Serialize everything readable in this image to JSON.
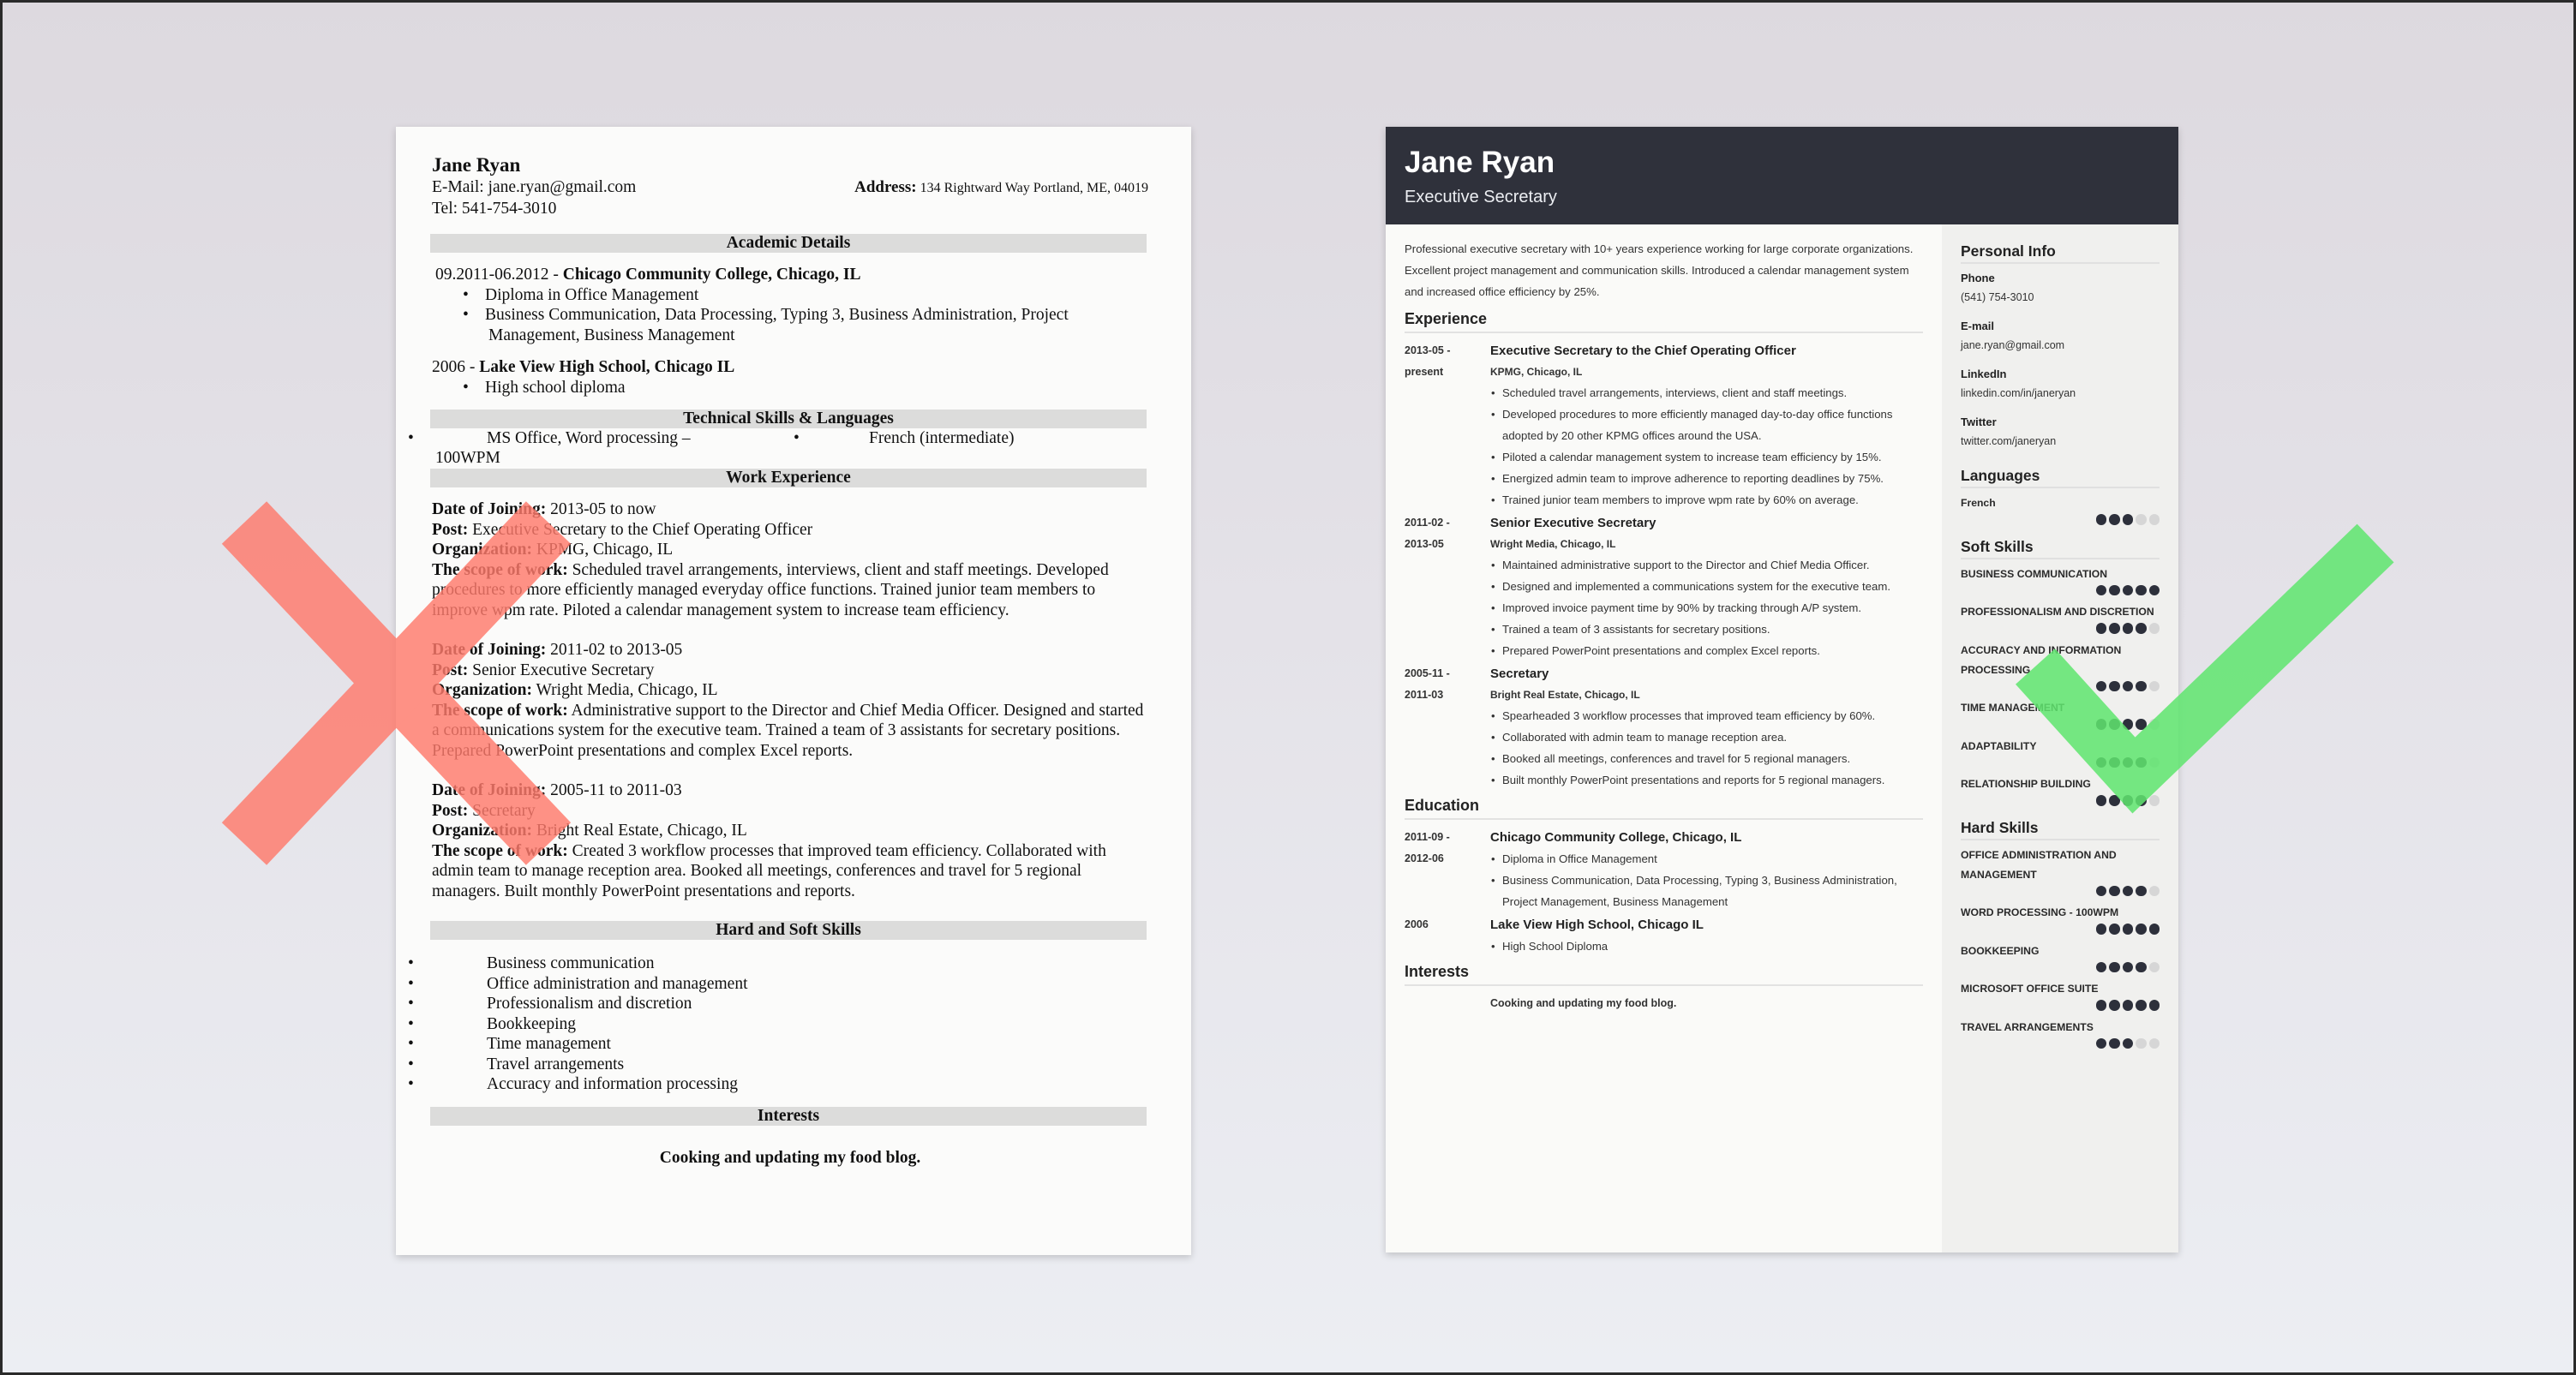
{
  "bad_resume": {
    "name": "Jane Ryan",
    "email_label": "E-Mail:",
    "email": "jane.ryan@gmail.com",
    "address_label": "Address:",
    "address": "134 Rightward Way Portland, ME, 04019",
    "tel_label": "Tel:",
    "tel": "541-754-3010",
    "sections": {
      "academic": "Academic Details",
      "technical": "Technical Skills & Languages",
      "work": "Work Experience",
      "skills": "Hard and Soft Skills",
      "interests": "Interests"
    },
    "education": [
      {
        "dates": "09.2011-06.2012 - ",
        "school": "Chicago Community College, Chicago, IL",
        "items": [
          "Diploma in Office Management",
          "Business Communication, Data Processing, Typing 3, Business Administration, Project",
          "Management, Business Management"
        ]
      },
      {
        "dates": "2006 - ",
        "school": "Lake View High School, Chicago IL",
        "items": [
          "High school diploma"
        ]
      }
    ],
    "technical": {
      "item1_line1": "MS Office, Word processing –",
      "item1_line2": "100WPM",
      "item2": "French (intermediate)"
    },
    "labels": {
      "date": "Date of Joining:",
      "post": "Post:",
      "org": "Organization:",
      "scope": "The scope of work:"
    },
    "jobs": [
      {
        "date": "2013-05 to now",
        "post": "Executive Secretary to the Chief Operating Officer",
        "org": "KPMG, Chicago, IL",
        "scope": "Scheduled travel arrangements, interviews, client and staff meetings. Developed procedures to more efficiently managed everyday office functions. Trained junior team members to improve wpm rate. Piloted a calendar management system to increase team efficiency."
      },
      {
        "date": "2011-02 to 2013-05",
        "post": "Senior Executive Secretary",
        "org": "Wright Media, Chicago, IL",
        "scope": "Administrative support to the Director and Chief Media Officer. Designed and started a communications system for the executive team. Trained a team of 3 assistants for secretary positions. Prepared PowerPoint presentations and complex Excel reports."
      },
      {
        "date": "2005-11 to 2011-03",
        "post": "Secretary",
        "org": "Bright Real Estate, Chicago, IL",
        "scope": "Created 3 workflow processes that improved team efficiency. Collaborated with admin team to manage reception area. Booked all meetings, conferences and travel for 5 regional managers. Built monthly PowerPoint presentations and reports."
      }
    ],
    "skills": [
      "Business communication",
      "Office administration and management",
      "Professionalism and discretion",
      "Bookkeeping",
      "Time management",
      "Travel arrangements",
      "Accuracy and information processing"
    ],
    "interests": "Cooking and updating my food blog."
  },
  "good_resume": {
    "name": "Jane Ryan",
    "title": "Executive Secretary",
    "summary": "Professional executive secretary with 10+ years experience working for large corporate organizations. Excellent project management and communication skills. Introduced a calendar management system and increased office efficiency by 25%.",
    "headings": {
      "experience": "Experience",
      "education": "Education",
      "interests": "Interests",
      "personal": "Personal Info",
      "languages": "Languages",
      "soft": "Soft Skills",
      "hard": "Hard Skills"
    },
    "experience": [
      {
        "date_line1": "2013-05 -",
        "date_line2": "present",
        "role": "Executive Secretary to the Chief Operating Officer",
        "org": "KPMG, Chicago, IL",
        "bullets": [
          "Scheduled travel arrangements, interviews, client and staff meetings.",
          "Developed procedures to more efficiently managed day-to-day office functions adopted by 20 other KPMG offices around the USA.",
          "Piloted a calendar management system to increase team efficiency by 15%.",
          "Energized admin team to improve adherence to reporting deadlines by 75%.",
          "Trained junior team members to improve wpm rate by 60% on average."
        ]
      },
      {
        "date_line1": "2011-02 -",
        "date_line2": "2013-05",
        "role": "Senior Executive Secretary",
        "org": "Wright Media, Chicago, IL",
        "bullets": [
          "Maintained administrative support to the Director and Chief Media Officer.",
          "Designed and implemented a communications system for the executive team.",
          "Improved invoice payment time by 90% by tracking through A/P system.",
          "Trained a team of 3 assistants for secretary positions.",
          "Prepared PowerPoint presentations and complex Excel reports."
        ]
      },
      {
        "date_line1": "2005-11 -",
        "date_line2": "2011-03",
        "role": "Secretary",
        "org": "Bright Real Estate, Chicago, IL",
        "bullets": [
          "Spearheaded 3 workflow processes that improved team efficiency by 60%.",
          "Collaborated with admin team to manage reception area.",
          "Booked all meetings, conferences and travel for 5 regional managers.",
          "Built monthly PowerPoint presentations and reports for 5 regional managers."
        ]
      }
    ],
    "education": [
      {
        "date_line1": "2011-09 -",
        "date_line2": "2012-06",
        "school": "Chicago Community College, Chicago, IL",
        "bullets": [
          "Diploma in Office Management",
          "Business Communication, Data Processing, Typing 3, Business Administration, Project Management, Business Management"
        ]
      },
      {
        "date_line1": "2006",
        "date_line2": "",
        "school": "Lake View High School, Chicago IL",
        "bullets": [
          "High School Diploma"
        ]
      }
    ],
    "interests": "Cooking and updating my food blog.",
    "personal_info": [
      {
        "label": "Phone",
        "value": "(541) 754-3010"
      },
      {
        "label": "E-mail",
        "value": "jane.ryan@gmail.com"
      },
      {
        "label": "LinkedIn",
        "value": "linkedin.com/in/janeryan"
      },
      {
        "label": "Twitter",
        "value": "twitter.com/janeryan"
      }
    ],
    "languages": [
      {
        "name": "French",
        "level": 3,
        "max": 5
      }
    ],
    "soft_skills": [
      {
        "name": "Business Communication",
        "level": 5,
        "max": 5
      },
      {
        "name": "Professionalism and Discretion",
        "level": 4,
        "max": 5
      },
      {
        "name": "Accuracy and Information Processing",
        "level": 4,
        "max": 5
      },
      {
        "name": "Time Management",
        "level": 4,
        "max": 5
      },
      {
        "name": "Adaptability",
        "level": 4,
        "max": 5
      },
      {
        "name": "Relationship Building",
        "level": 4,
        "max": 5
      }
    ],
    "hard_skills": [
      {
        "name": "Office Administration and Management",
        "level": 4,
        "max": 5
      },
      {
        "name": "Word Processing - 100WPM",
        "level": 5,
        "max": 5
      },
      {
        "name": "Bookkeeping",
        "level": 4,
        "max": 5
      },
      {
        "name": "Microsoft Office Suite",
        "level": 5,
        "max": 5
      },
      {
        "name": "Travel Arrangements",
        "level": 3,
        "max": 5
      }
    ]
  },
  "overlays": {
    "bad_mark": "cross-icon",
    "good_mark": "checkmark-icon",
    "colors": {
      "cross": "#ff7a6c",
      "check": "#5fe56f",
      "header_bg": "#2f313b",
      "dot_filled": "#2d303b",
      "dot_empty": "#d6d6d6"
    }
  }
}
